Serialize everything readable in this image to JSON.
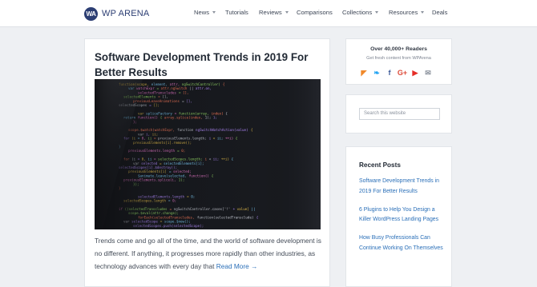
{
  "header": {
    "logo_mark": "WA",
    "logo_text": "WP ARENA",
    "nav": [
      {
        "label": "News",
        "dropdown": true
      },
      {
        "label": "Tutorials",
        "dropdown": false
      },
      {
        "label": "Reviews",
        "dropdown": true
      },
      {
        "label": "Comparisons",
        "dropdown": false
      },
      {
        "label": "Collections",
        "dropdown": true
      },
      {
        "label": "Resources",
        "dropdown": true
      },
      {
        "label": "Deals",
        "dropdown": false
      }
    ]
  },
  "post": {
    "title": "Software Development Trends in 2019 For Better Results",
    "excerpt": "Trends come and go all of the time, and the world of software development is no different. If anything, it progresses more rapidly than other industries, as technology advances with every day that",
    "read_more": "Read More →",
    "image_code_lines": [
      "function(scope, element, attr, ngSwitchController) {",
      "var watchExpr = attr.ngSwitch || attr.on,",
      "selectedTranscludes = [],",
      "selectedElements = [],",
      "previousLeaveAnimations = [],",
      "selectedScopes = [];",
      "",
      "var spliceFactory = function(array, index) {",
      "return function() { array.splice(index, 1); };",
      "};",
      "",
      "scope.$watch(watchExpr, function ngSwitchWatchAction(value) {",
      "var i, ii;",
      "for (i = 0, ii = previousElements.length; i < ii; ++i) {",
      "previousElements[i].remove();",
      "}",
      "previousElements.length = 0;",
      "",
      "for (i = 0, ii = selectedScopes.length; i < ii; ++i) {",
      "var selected = selectedElements[i];",
      "selectedScopes[i].$destroy();",
      "previousElements[i] = selected;",
      "$animate.leave(selected, function() {",
      "previousElements.splice(i, 1);",
      "});",
      "}",
      "",
      "selectedElements.length = 0;",
      "selectedScopes.length = 0;",
      "",
      "if ((selectedTranscludes = ngSwitchController.cases['!' + value] ||",
      "scope.$eval(attr.change);",
      "forEach(selectedTranscludes, function(selectedTransclude) {",
      "var selectedScope = scope.$new();",
      "selectedScopes.push(selectedScope);"
    ]
  },
  "sidebar": {
    "readers_title": "Over 40,000+ Readers",
    "readers_sub": "Get fresh content from WPArena",
    "social_icons": [
      {
        "name": "rss-icon",
        "glyph": "◤",
        "color": "#f0892b"
      },
      {
        "name": "twitter-icon",
        "glyph": "❧",
        "color": "#1da1f2"
      },
      {
        "name": "facebook-icon",
        "glyph": "f",
        "color": "#3b5998"
      },
      {
        "name": "google-plus-icon",
        "glyph": "G+",
        "color": "#dd4b39"
      },
      {
        "name": "youtube-icon",
        "glyph": "▶",
        "color": "#e52d27"
      },
      {
        "name": "email-icon",
        "glyph": "✉",
        "color": "#8a919c"
      }
    ],
    "search_placeholder": "Search this website",
    "recent_title": "Recent Posts",
    "recent_posts": [
      "Software Development Trends in 2019 For Better Results",
      "6 Plugins to Help You Design a Killer WordPress Landing Pages",
      "How Busy Professionals Can Continue Working On Themselves"
    ]
  },
  "colors": {
    "brand": "#2c3e73",
    "link": "#2a6fb8",
    "page_bg": "#eef0f3"
  }
}
